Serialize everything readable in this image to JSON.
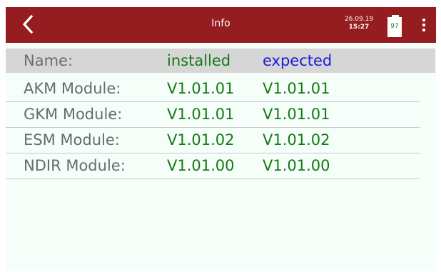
{
  "header": {
    "title": "Info",
    "date": "26.09.19",
    "time": "15:27",
    "battery_level": "97",
    "back_icon": "chevron-left-icon",
    "menu_icon": "vertical-dots-icon"
  },
  "table": {
    "columns": {
      "name": "Name:",
      "installed": "installed",
      "expected": "expected"
    },
    "rows": [
      {
        "name": "AKM Module:",
        "installed": "V1.01.01",
        "expected": "V1.01.01"
      },
      {
        "name": "GKM Module:",
        "installed": "V1.01.01",
        "expected": "V1.01.01"
      },
      {
        "name": "ESM Module:",
        "installed": "V1.01.02",
        "expected": "V1.01.02"
      },
      {
        "name": "NDIR Module:",
        "installed": "V1.01.00",
        "expected": "V1.01.00"
      }
    ]
  },
  "colors": {
    "header_bg": "#951c1f",
    "content_bg": "#f5fef8",
    "header_row_bg": "#d6d6d6",
    "label_gray": "#6b6b6b",
    "value_green": "#157a15",
    "expected_blue": "#1a1ad8",
    "battery_text_green": "#1a8a1a"
  }
}
